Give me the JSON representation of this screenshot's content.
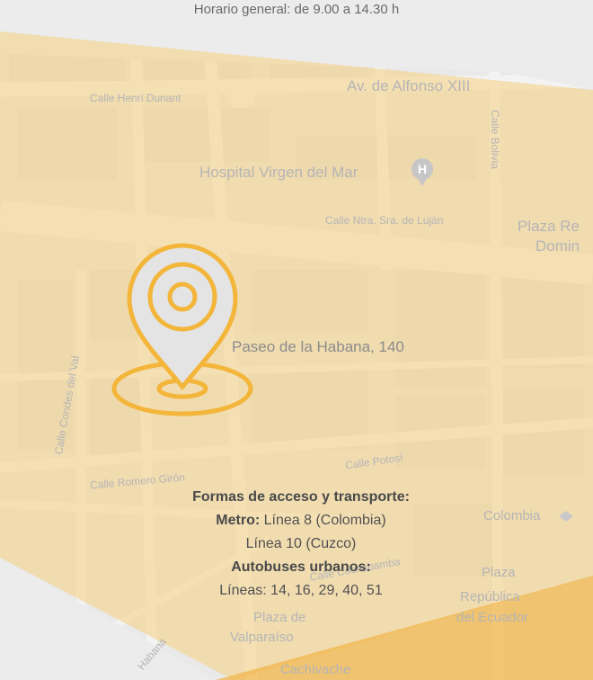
{
  "header": {
    "hours": "Horario general: de 9.00 a 14.30 h"
  },
  "map": {
    "streets": {
      "henri_dunant": "Calle Henri Dunant",
      "alfonso": "Av. de Alfonso XIII",
      "bolivia": "Calle Bolivia",
      "hospital": "Hospital Virgen del Mar",
      "lujan": "Calle Ntra. Sra. de Luján",
      "plaza_re_1": "Plaza Re",
      "plaza_re_2": "Domin",
      "condes": "Calle Condes del Val",
      "romero": "Calle Romero Girón",
      "potosi": "Calle Potosí",
      "colombia": "Colombia",
      "cochabamba": "Calle Cochabamba",
      "plaza_ecuador_1": "Plaza",
      "plaza_ecuador_2": "República",
      "plaza_ecuador_3": "del Ecuador",
      "valparaiso_1": "Plaza de",
      "valparaiso_2": "Valparaíso",
      "cachivache": "Cachivache",
      "habana_small": "Habana"
    },
    "address": "Paseo de la Habana, 140",
    "colors": {
      "accent": "#f3b53a",
      "pin_fill": "#e3e3e3",
      "overlay": "#f6d48c"
    }
  },
  "transport": {
    "title": "Formas de acceso y transporte:",
    "metro_label": "Metro:",
    "metro_line1": "Línea 8 (Colombia)",
    "metro_line2": "Línea 10 (Cuzco)",
    "bus_label": "Autobuses urbanos:",
    "bus_lines": "Líneas: 14, 16, 29, 40, 51"
  }
}
